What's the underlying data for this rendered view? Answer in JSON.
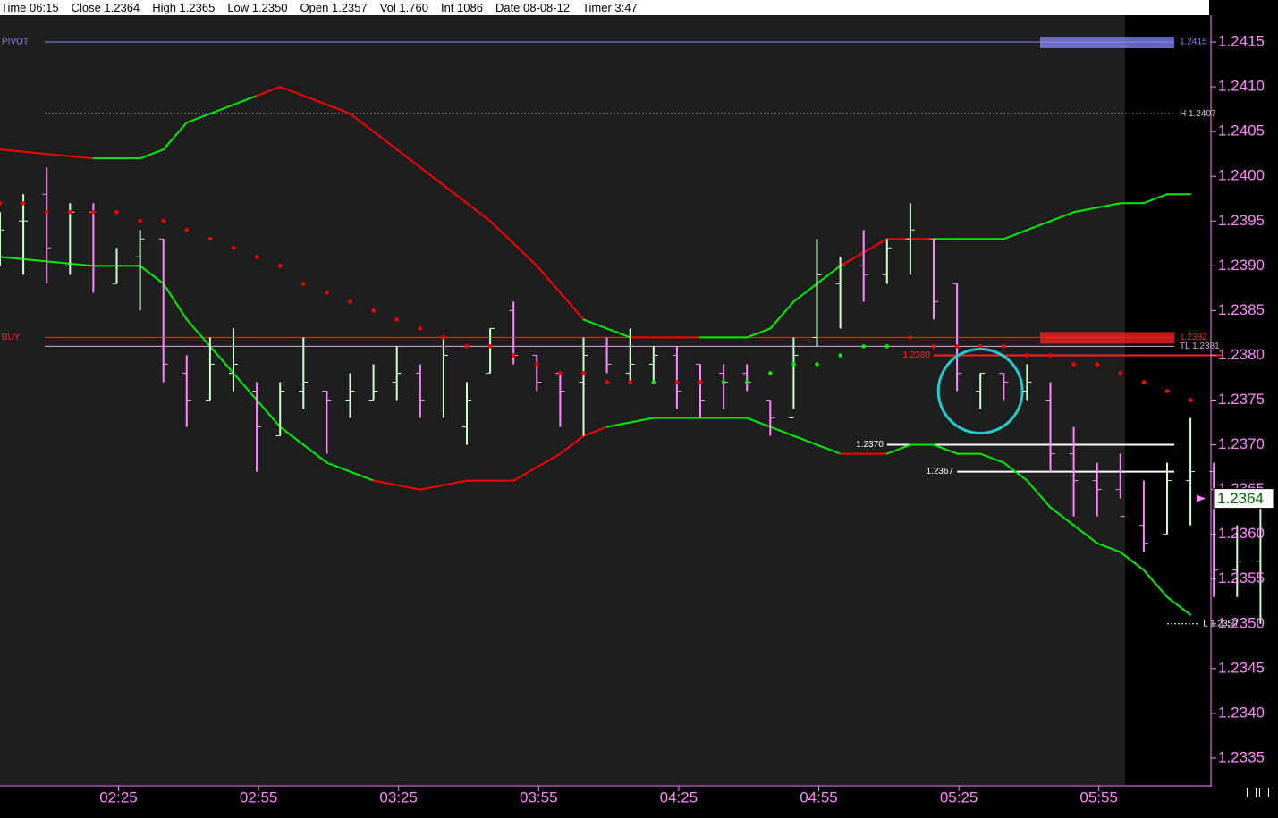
{
  "header": {
    "time": "Time 06:15",
    "close": "Close 1.2364",
    "high": "High 1.2365",
    "low": "Low 1.2350",
    "open": "Open 1.2357",
    "vol": "Vol 1.760",
    "int": "Int 1086",
    "date": "Date 08-08-12",
    "timer": "Timer 3:47"
  },
  "colors": {
    "background": "#1e1e1e",
    "future_zone": "#000000",
    "up_bar": "#ccffcc",
    "down_bar": "#ff88ff",
    "band_up": "#00ee00",
    "band_down": "#ff0000",
    "axis": "#ff88ff",
    "pivot": "#8888ff",
    "circle": "#22cccc"
  },
  "chart_data": {
    "type": "ohlc",
    "ylim": [
      1.2332,
      1.2418
    ],
    "yticks": [
      "1.2415",
      "1.2410",
      "1.2405",
      "1.2400",
      "1.2395",
      "1.2390",
      "1.2385",
      "1.2380",
      "1.2375",
      "1.2370",
      "1.2365",
      "1.2360",
      "1.2355",
      "1.2350",
      "1.2345",
      "1.2340",
      "1.2335"
    ],
    "xticks": [
      {
        "label": "02:25",
        "bar": 5
      },
      {
        "label": "02:55",
        "bar": 11
      },
      {
        "label": "03:25",
        "bar": 17
      },
      {
        "label": "03:55",
        "bar": 23
      },
      {
        "label": "04:25",
        "bar": 29
      },
      {
        "label": "04:55",
        "bar": 35
      },
      {
        "label": "05:25",
        "bar": 41
      },
      {
        "label": "05:55",
        "bar": 47
      }
    ],
    "last_price_label": "1.2364",
    "last_price": 1.2364,
    "bars": [
      {
        "o": 1.2394,
        "h": 1.2396,
        "l": 1.239,
        "c": 1.2394
      },
      {
        "o": 1.2395,
        "h": 1.2398,
        "l": 1.2389,
        "c": 1.2395
      },
      {
        "o": 1.2398,
        "h": 1.2401,
        "l": 1.2388,
        "c": 1.2392
      },
      {
        "o": 1.239,
        "h": 1.2397,
        "l": 1.2389,
        "c": 1.2396
      },
      {
        "o": 1.2396,
        "h": 1.2397,
        "l": 1.2387,
        "c": 1.239
      },
      {
        "o": 1.2388,
        "h": 1.2392,
        "l": 1.2388,
        "c": 1.239
      },
      {
        "o": 1.2391,
        "h": 1.2394,
        "l": 1.2385,
        "c": 1.2393
      },
      {
        "o": 1.2393,
        "h": 1.2393,
        "l": 1.2377,
        "c": 1.2379
      },
      {
        "o": 1.2378,
        "h": 1.238,
        "l": 1.2372,
        "c": 1.2375
      },
      {
        "o": 1.2375,
        "h": 1.2382,
        "l": 1.2375,
        "c": 1.2379
      },
      {
        "o": 1.2378,
        "h": 1.2383,
        "l": 1.2376,
        "c": 1.2379
      },
      {
        "o": 1.2376,
        "h": 1.2377,
        "l": 1.2367,
        "c": 1.2372
      },
      {
        "o": 1.2371,
        "h": 1.2377,
        "l": 1.2371,
        "c": 1.2376
      },
      {
        "o": 1.2376,
        "h": 1.2382,
        "l": 1.2374,
        "c": 1.2377
      },
      {
        "o": 1.2376,
        "h": 1.2376,
        "l": 1.2369,
        "c": 1.2375
      },
      {
        "o": 1.2375,
        "h": 1.2378,
        "l": 1.2373,
        "c": 1.2376
      },
      {
        "o": 1.2375,
        "h": 1.2379,
        "l": 1.2375,
        "c": 1.2376
      },
      {
        "o": 1.2377,
        "h": 1.2381,
        "l": 1.2375,
        "c": 1.2378
      },
      {
        "o": 1.2378,
        "h": 1.2379,
        "l": 1.2373,
        "c": 1.2375
      },
      {
        "o": 1.2374,
        "h": 1.2382,
        "l": 1.2373,
        "c": 1.238
      },
      {
        "o": 1.2372,
        "h": 1.2377,
        "l": 1.237,
        "c": 1.2375
      },
      {
        "o": 1.2378,
        "h": 1.2383,
        "l": 1.2378,
        "c": 1.2383
      },
      {
        "o": 1.2385,
        "h": 1.2386,
        "l": 1.2379,
        "c": 1.238
      },
      {
        "o": 1.238,
        "h": 1.238,
        "l": 1.2376,
        "c": 1.2377
      },
      {
        "o": 1.2378,
        "h": 1.2378,
        "l": 1.2372,
        "c": 1.2376
      },
      {
        "o": 1.2377,
        "h": 1.2382,
        "l": 1.2371,
        "c": 1.238
      },
      {
        "o": 1.2381,
        "h": 1.2382,
        "l": 1.2378,
        "c": 1.2379
      },
      {
        "o": 1.2378,
        "h": 1.2383,
        "l": 1.2377,
        "c": 1.2379
      },
      {
        "o": 1.2379,
        "h": 1.2381,
        "l": 1.2377,
        "c": 1.238
      },
      {
        "o": 1.238,
        "h": 1.2381,
        "l": 1.2374,
        "c": 1.2376
      },
      {
        "o": 1.2379,
        "h": 1.2379,
        "l": 1.2373,
        "c": 1.2375
      },
      {
        "o": 1.2378,
        "h": 1.2379,
        "l": 1.2374,
        "c": 1.2377
      },
      {
        "o": 1.2378,
        "h": 1.2379,
        "l": 1.2376,
        "c": 1.2377
      },
      {
        "o": 1.2375,
        "h": 1.2375,
        "l": 1.2371,
        "c": 1.2373
      },
      {
        "o": 1.2373,
        "h": 1.2382,
        "l": 1.2374,
        "c": 1.238
      },
      {
        "o": 1.2382,
        "h": 1.2393,
        "l": 1.2381,
        "c": 1.2389
      },
      {
        "o": 1.2388,
        "h": 1.2391,
        "l": 1.2383,
        "c": 1.239
      },
      {
        "o": 1.239,
        "h": 1.2394,
        "l": 1.2386,
        "c": 1.2389
      },
      {
        "o": 1.2389,
        "h": 1.2393,
        "l": 1.2388,
        "c": 1.2392
      },
      {
        "o": 1.2393,
        "h": 1.2397,
        "l": 1.2389,
        "c": 1.2394
      },
      {
        "o": 1.2393,
        "h": 1.2393,
        "l": 1.2384,
        "c": 1.2386
      },
      {
        "o": 1.2388,
        "h": 1.2388,
        "l": 1.2376,
        "c": 1.2378
      },
      {
        "o": 1.2376,
        "h": 1.2378,
        "l": 1.2374,
        "c": 1.2378
      },
      {
        "o": 1.2378,
        "h": 1.2378,
        "l": 1.2375,
        "c": 1.2377
      },
      {
        "o": 1.2376,
        "h": 1.2379,
        "l": 1.2375,
        "c": 1.2377
      },
      {
        "o": 1.2375,
        "h": 1.2377,
        "l": 1.2367,
        "c": 1.2369
      },
      {
        "o": 1.2369,
        "h": 1.2372,
        "l": 1.2362,
        "c": 1.2366
      },
      {
        "o": 1.2366,
        "h": 1.2368,
        "l": 1.2362,
        "c": 1.2365
      },
      {
        "o": 1.2365,
        "h": 1.2369,
        "l": 1.2364,
        "c": 1.2362
      },
      {
        "o": 1.2361,
        "h": 1.2366,
        "l": 1.2358,
        "c": 1.2359
      },
      {
        "o": 1.236,
        "h": 1.2368,
        "l": 1.236,
        "c": 1.2366
      },
      {
        "o": 1.2366,
        "h": 1.2373,
        "l": 1.2361,
        "c": 1.2367
      },
      {
        "o": 1.2367,
        "h": 1.2368,
        "l": 1.2353,
        "c": 1.2356
      },
      {
        "o": 1.2356,
        "h": 1.2361,
        "l": 1.2353,
        "c": 1.2357
      },
      {
        "o": 1.2357,
        "h": 1.2365,
        "l": 1.235,
        "c": 1.2364
      }
    ],
    "upper_band": [
      [
        0,
        1.2403,
        "d"
      ],
      [
        4,
        1.2402,
        "d"
      ],
      [
        6,
        1.2402,
        "u"
      ],
      [
        7,
        1.2403,
        "u"
      ],
      [
        8,
        1.2406,
        "u"
      ],
      [
        9,
        1.2407,
        "u"
      ],
      [
        10,
        1.2408,
        "u"
      ],
      [
        11,
        1.2409,
        "u"
      ],
      [
        12,
        1.241,
        "d"
      ],
      [
        13,
        1.2409,
        "d"
      ],
      [
        15,
        1.2407,
        "d"
      ],
      [
        17,
        1.2403,
        "d"
      ],
      [
        19,
        1.2399,
        "d"
      ],
      [
        21,
        1.2395,
        "d"
      ],
      [
        23,
        1.239,
        "d"
      ],
      [
        25,
        1.2384,
        "d"
      ],
      [
        26,
        1.2383,
        "u"
      ],
      [
        27,
        1.2382,
        "u"
      ],
      [
        28,
        1.2382,
        "d"
      ],
      [
        30,
        1.2382,
        "d"
      ],
      [
        32,
        1.2382,
        "u"
      ],
      [
        33,
        1.2383,
        "u"
      ],
      [
        34,
        1.2386,
        "u"
      ],
      [
        35,
        1.2388,
        "u"
      ],
      [
        36,
        1.239,
        "u"
      ],
      [
        38,
        1.2393,
        "d"
      ],
      [
        40,
        1.2393,
        "d"
      ],
      [
        41,
        1.2393,
        "u"
      ],
      [
        43,
        1.2393,
        "u"
      ],
      [
        44,
        1.2394,
        "u"
      ],
      [
        45,
        1.2395,
        "u"
      ],
      [
        46,
        1.2396,
        "u"
      ],
      [
        48,
        1.2397,
        "u"
      ],
      [
        49,
        1.2397,
        "u"
      ],
      [
        50,
        1.2398,
        "u"
      ],
      [
        51,
        1.2398,
        "u"
      ]
    ],
    "lower_band": [
      [
        0,
        1.2391,
        "u"
      ],
      [
        4,
        1.239,
        "u"
      ],
      [
        6,
        1.239,
        "u"
      ],
      [
        7,
        1.2388,
        "u"
      ],
      [
        8,
        1.2384,
        "u"
      ],
      [
        9,
        1.2381,
        "u"
      ],
      [
        10,
        1.2378,
        "u"
      ],
      [
        11,
        1.2375,
        "u"
      ],
      [
        12,
        1.2372,
        "u"
      ],
      [
        13,
        1.237,
        "u"
      ],
      [
        14,
        1.2368,
        "u"
      ],
      [
        15,
        1.2367,
        "u"
      ],
      [
        16,
        1.2366,
        "u"
      ],
      [
        18,
        1.2365,
        "d"
      ],
      [
        20,
        1.2366,
        "d"
      ],
      [
        22,
        1.2366,
        "d"
      ],
      [
        24,
        1.2369,
        "d"
      ],
      [
        25,
        1.2371,
        "d"
      ],
      [
        26,
        1.2372,
        "d"
      ],
      [
        28,
        1.2373,
        "u"
      ],
      [
        30,
        1.2373,
        "u"
      ],
      [
        32,
        1.2373,
        "u"
      ],
      [
        33,
        1.2372,
        "u"
      ],
      [
        34,
        1.2371,
        "u"
      ],
      [
        35,
        1.237,
        "u"
      ],
      [
        36,
        1.2369,
        "u"
      ],
      [
        37,
        1.2369,
        "d"
      ],
      [
        38,
        1.2369,
        "d"
      ],
      [
        39,
        1.237,
        "u"
      ],
      [
        40,
        1.237,
        "u"
      ],
      [
        41,
        1.2369,
        "u"
      ],
      [
        42,
        1.2369,
        "u"
      ],
      [
        43,
        1.2368,
        "u"
      ],
      [
        44,
        1.2366,
        "u"
      ],
      [
        45,
        1.2363,
        "u"
      ],
      [
        46,
        1.2361,
        "u"
      ],
      [
        47,
        1.2359,
        "u"
      ],
      [
        48,
        1.2358,
        "u"
      ],
      [
        49,
        1.2356,
        "u"
      ],
      [
        50,
        1.2353,
        "u"
      ],
      [
        51,
        1.2351,
        "u"
      ]
    ],
    "psar": [
      [
        0,
        1.2397,
        "d"
      ],
      [
        1,
        1.2397,
        "d"
      ],
      [
        2,
        1.2396,
        "d"
      ],
      [
        3,
        1.2396,
        "d"
      ],
      [
        4,
        1.2396,
        "d"
      ],
      [
        5,
        1.2396,
        "d"
      ],
      [
        6,
        1.2395,
        "d"
      ],
      [
        7,
        1.2395,
        "d"
      ],
      [
        8,
        1.2394,
        "d"
      ],
      [
        9,
        1.2393,
        "d"
      ],
      [
        10,
        1.2392,
        "d"
      ],
      [
        11,
        1.2391,
        "d"
      ],
      [
        12,
        1.239,
        "d"
      ],
      [
        13,
        1.2388,
        "d"
      ],
      [
        14,
        1.2387,
        "d"
      ],
      [
        15,
        1.2386,
        "d"
      ],
      [
        16,
        1.2385,
        "d"
      ],
      [
        17,
        1.2384,
        "d"
      ],
      [
        18,
        1.2383,
        "d"
      ],
      [
        19,
        1.2382,
        "d"
      ],
      [
        20,
        1.2381,
        "d"
      ],
      [
        21,
        1.2381,
        "d"
      ],
      [
        22,
        1.238,
        "d"
      ],
      [
        23,
        1.2379,
        "d"
      ],
      [
        24,
        1.2378,
        "d"
      ],
      [
        25,
        1.2378,
        "d"
      ],
      [
        26,
        1.2377,
        "d"
      ],
      [
        27,
        1.2377,
        "d"
      ],
      [
        28,
        1.2377,
        "u"
      ],
      [
        29,
        1.2377,
        "d"
      ],
      [
        30,
        1.2377,
        "d"
      ],
      [
        31,
        1.2377,
        "u"
      ],
      [
        32,
        1.2377,
        "u"
      ],
      [
        33,
        1.2378,
        "u"
      ],
      [
        34,
        1.2379,
        "u"
      ],
      [
        35,
        1.2379,
        "u"
      ],
      [
        36,
        1.238,
        "u"
      ],
      [
        37,
        1.2381,
        "u"
      ],
      [
        38,
        1.2381,
        "u"
      ],
      [
        39,
        1.2382,
        "d"
      ],
      [
        40,
        1.2381,
        "d"
      ],
      [
        41,
        1.2381,
        "d"
      ],
      [
        42,
        1.2381,
        "d"
      ],
      [
        43,
        1.2381,
        "d"
      ],
      [
        44,
        1.238,
        "d"
      ],
      [
        45,
        1.238,
        "d"
      ],
      [
        46,
        1.2379,
        "d"
      ],
      [
        47,
        1.2379,
        "d"
      ],
      [
        48,
        1.2378,
        "d"
      ],
      [
        49,
        1.2377,
        "d"
      ],
      [
        50,
        1.2376,
        "d"
      ],
      [
        51,
        1.2375,
        "d"
      ]
    ],
    "levels": [
      {
        "name": "PIVOT",
        "label": "PIVOT",
        "value_label": "1.2415",
        "value": 1.2415,
        "color": "#8888ff",
        "style": "solid",
        "from_bar": -1,
        "to_bar": 50,
        "highlight": true
      },
      {
        "name": "H",
        "label": "",
        "value_label": "H 1.2407",
        "value": 1.2407,
        "color": "#cccccc",
        "style": "dashed",
        "from_bar": -1,
        "to_bar": 50,
        "highlight": false
      },
      {
        "name": "BUY",
        "label": "BUY",
        "value_label": "1.2382",
        "value": 1.2382,
        "color": "#ff2222",
        "style": "solid",
        "from_bar": -1,
        "to_bar": 50,
        "highlight": true
      },
      {
        "name": "TL",
        "label": "",
        "value_label": "TL 1.2381",
        "value": 1.2381,
        "color": "#ddaadd",
        "style": "solid",
        "from_bar": -1,
        "to_bar": 50,
        "highlight": false
      },
      {
        "name": "R1380",
        "label": "1.2380",
        "value_label": "",
        "value": 1.238,
        "color": "#ff2222",
        "style": "solid",
        "from_bar": 40,
        "to_bar": 52,
        "highlight": false
      },
      {
        "name": "W1370",
        "label": "1.2370",
        "value_label": "",
        "value": 1.237,
        "color": "#ffffff",
        "style": "solid",
        "from_bar": 38,
        "to_bar": 50,
        "highlight": false
      },
      {
        "name": "W1367",
        "label": "1.2367",
        "value_label": "",
        "value": 1.2367,
        "color": "#ffffff",
        "style": "solid",
        "from_bar": 41,
        "to_bar": 50,
        "highlight": false
      },
      {
        "name": "L",
        "label": "",
        "value_label": "L 1.2350",
        "value": 1.235,
        "color": "#ffffff",
        "style": "dashed",
        "from_bar": 50,
        "to_bar": 51,
        "highlight": false
      }
    ],
    "annotation": {
      "type": "circle",
      "bar": 42,
      "value": 1.2376,
      "radius_bars": 1.8
    }
  }
}
